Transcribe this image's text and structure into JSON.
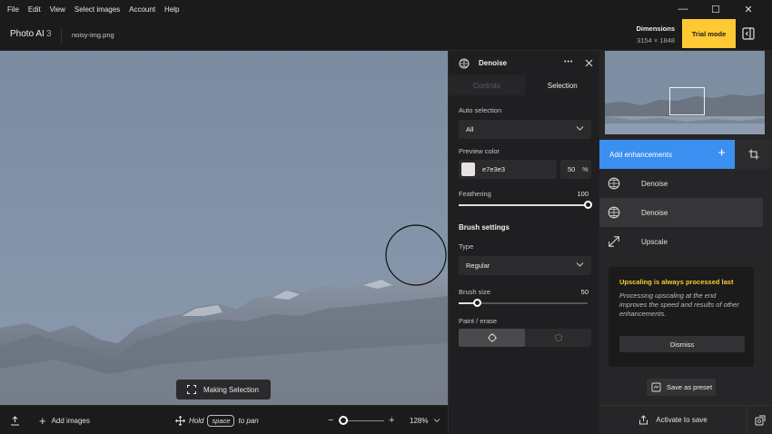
{
  "menu": [
    "File",
    "Edit",
    "View",
    "Select images",
    "Account",
    "Help"
  ],
  "window_controls": {
    "minimize": "—",
    "maximize": "☐",
    "close": "✕"
  },
  "header": {
    "app_name": "Photo AI",
    "app_version": "3",
    "filename": "noisy-img.png",
    "dimensions_label": "Dimensions",
    "dimensions_value": "3154 × 1848",
    "trial_label": "Trial mode"
  },
  "canvas": {
    "making_selection_label": "Making Selection"
  },
  "bottom_bar": {
    "add_images_label": "Add images",
    "hint_hold": "Hold",
    "hint_key": "space",
    "hint_action": "to pan",
    "zoom_level": "128%",
    "zoom_fraction": 0.1
  },
  "selection_panel": {
    "title": "Denoise",
    "more_glyph": "•••",
    "tabs": [
      {
        "label": "Controls",
        "active": false
      },
      {
        "label": "Selection",
        "active": true
      }
    ],
    "auto_selection_label": "Auto selection",
    "auto_selection_value": "All",
    "preview_color_label": "Preview color",
    "preview_color_hex": "e7e3e3",
    "preview_opacity_value": "50",
    "preview_opacity_unit": "%",
    "feathering_label": "Feathering",
    "feathering_value": "100",
    "feathering_fraction": 1.0,
    "brush_settings_label": "Brush settings",
    "type_label": "Type",
    "type_value": "Regular",
    "brush_size_label": "Brush size",
    "brush_size_value": "50",
    "brush_size_fraction": 0.14,
    "paint_erase_label": "Paint / erase"
  },
  "right_panel": {
    "add_enhancements_label": "Add enhancements",
    "enhancements": [
      {
        "label": "Denoise",
        "selected": false
      },
      {
        "label": "Denoise",
        "selected": true
      },
      {
        "label": "Upscale",
        "selected": false
      }
    ],
    "notice_title": "Upscaling is always processed last",
    "notice_body": "Processing upscaling at the end improves the speed and results of other enhancements.",
    "dismiss_label": "Dismiss",
    "save_preset_label": "Save as preset",
    "activate_label": "Activate to save"
  },
  "colors": {
    "accent_blue": "#3a8ff0",
    "trial_yellow": "#ffc933",
    "background": "#1b1b1c"
  }
}
